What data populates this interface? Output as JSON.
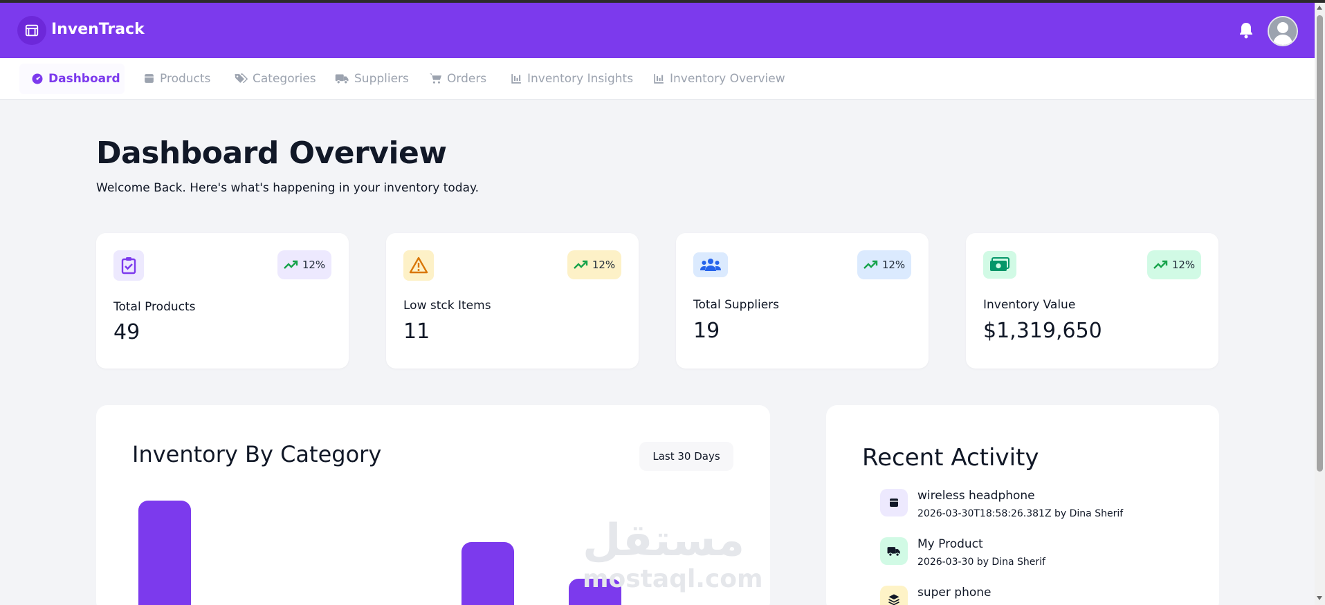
{
  "app": {
    "brand": "InvenTrack",
    "accent": "#7c3aed",
    "logo_icon": "store-icon",
    "notification_icon": "bell-icon",
    "avatar_icon": "user-avatar-icon"
  },
  "nav": {
    "items": [
      {
        "label": "Dashboard",
        "icon": "gauge-icon",
        "active": true
      },
      {
        "label": "Products",
        "icon": "box-icon",
        "active": false
      },
      {
        "label": "Categories",
        "icon": "tags-icon",
        "active": false
      },
      {
        "label": "Suppliers",
        "icon": "truck-icon",
        "active": false
      },
      {
        "label": "Orders",
        "icon": "cart-icon",
        "active": false
      },
      {
        "label": "Inventory Insights",
        "icon": "chart-icon",
        "active": false
      },
      {
        "label": "Inventory Overview",
        "icon": "chart-icon",
        "active": false
      }
    ]
  },
  "page": {
    "title": "Dashboard Overview",
    "subtitle": "Welcome Back. Here's what's happening in your inventory today."
  },
  "stats": [
    {
      "label": "Total Products",
      "value": "49",
      "trend": "12%",
      "icon": "clipboard-check-icon",
      "icon_bg": "#ede9fe",
      "icon_color": "#7c3aed",
      "badge_bg": "#ede9fe"
    },
    {
      "label": "Low stck Items",
      "value": "11",
      "trend": "12%",
      "icon": "warning-icon",
      "icon_bg": "#fdf1c7",
      "icon_color": "#d97706",
      "badge_bg": "#fdf1c7"
    },
    {
      "label": "Total Suppliers",
      "value": "19",
      "trend": "12%",
      "icon": "users-icon",
      "icon_bg": "#dbeafe",
      "icon_color": "#2563eb",
      "badge_bg": "#dbeafe"
    },
    {
      "label": "Inventory Value",
      "value": "$1,319,650",
      "trend": "12%",
      "icon": "money-icon",
      "icon_bg": "#d1fae5",
      "icon_color": "#059669",
      "badge_bg": "#d1fae5"
    }
  ],
  "trend_color": "#16a34a",
  "chart_panel": {
    "title": "Inventory By Category",
    "range_label": "Last 30 Days"
  },
  "chart_data": {
    "type": "bar",
    "title": "Inventory By Category",
    "bar_color": "#7c3aed",
    "slots": 6,
    "relative_heights": [
      1.0,
      0,
      0,
      0.63,
      0.3,
      0
    ],
    "note_visible": "chart is cropped at the bottom of the viewport; no axes or labels are visible"
  },
  "watermark": {
    "arabic": "مستقل",
    "latin": "mostaql.com"
  },
  "activity": {
    "title": "Recent Activity",
    "items": [
      {
        "name": "wireless headphone",
        "meta": "2026-03-30T18:58:26.381Z by Dina Sherif",
        "icon": "box-icon",
        "bg": "#ede9fe"
      },
      {
        "name": "My Product",
        "meta": "2026-03-30 by Dina Sherif",
        "icon": "truck-icon",
        "bg": "#d1fae5"
      },
      {
        "name": "super phone",
        "meta": "",
        "icon": "layers-icon",
        "bg": "#fef3c7"
      }
    ]
  }
}
